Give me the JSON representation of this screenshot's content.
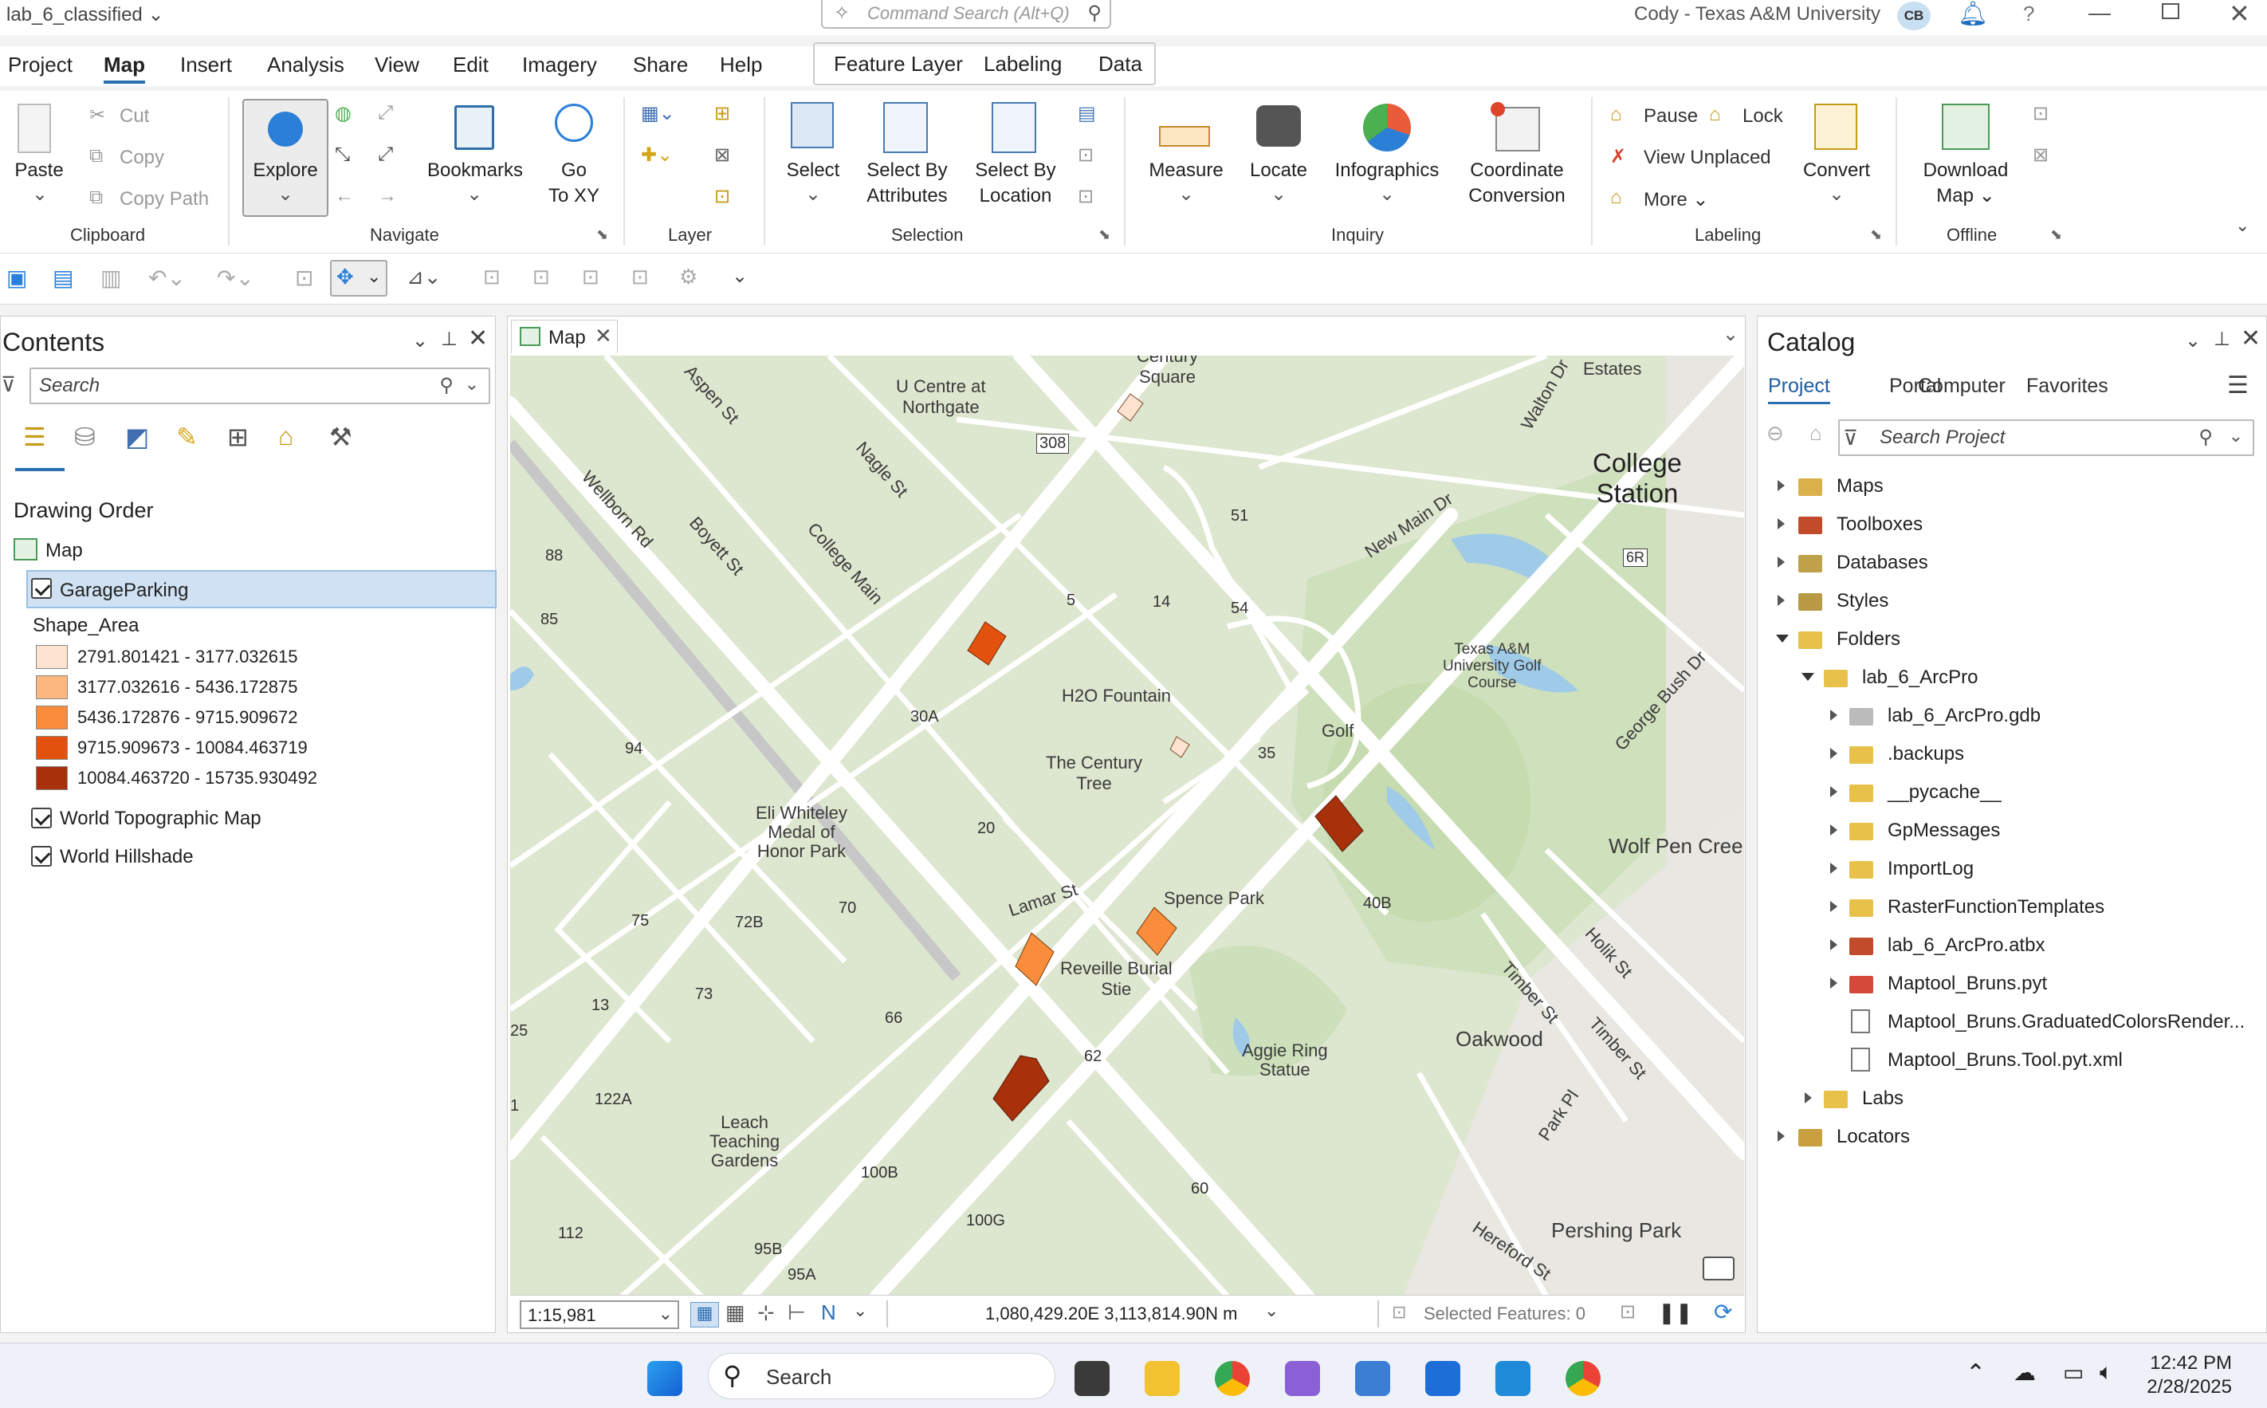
{
  "window": {
    "title": "lab_6_classified",
    "command_search_placeholder": "Command Search (Alt+Q)",
    "user": "Cody - Texas A&M University",
    "avatar_initials": "CB"
  },
  "ribbon_tabs": [
    "Project",
    "Map",
    "Insert",
    "Analysis",
    "View",
    "Edit",
    "Imagery",
    "Share",
    "Help"
  ],
  "active_tab": "Map",
  "context_tabs": [
    "Feature Layer",
    "Labeling",
    "Data"
  ],
  "ribbon": {
    "clipboard": {
      "paste": "Paste",
      "cut": "Cut",
      "copy": "Copy",
      "copy_path": "Copy Path",
      "group": "Clipboard"
    },
    "navigate": {
      "explore": "Explore",
      "bookmarks": "Bookmarks",
      "goto_xy_1": "Go",
      "goto_xy_2": "To XY",
      "group": "Navigate"
    },
    "layer": {
      "group": "Layer"
    },
    "selection": {
      "select": "Select",
      "by_attr_1": "Select By",
      "by_attr_2": "Attributes",
      "by_loc_1": "Select By",
      "by_loc_2": "Location",
      "group": "Selection"
    },
    "inquiry": {
      "measure": "Measure",
      "locate": "Locate",
      "infographics": "Infographics",
      "coord_1": "Coordinate",
      "coord_2": "Conversion",
      "group": "Inquiry"
    },
    "labeling": {
      "pause": "Pause",
      "lock": "Lock",
      "view_unplaced": "View Unplaced",
      "more": "More",
      "convert": "Convert",
      "group": "Labeling"
    },
    "offline": {
      "download_1": "Download",
      "download_2": "Map",
      "group": "Offline"
    }
  },
  "contents": {
    "title": "Contents",
    "search_placeholder": "Search",
    "drawing_order": "Drawing Order",
    "map": "Map",
    "layer": "GarageParking",
    "field": "Shape_Area",
    "legend": [
      {
        "label": "2791.801421 - 3177.032615",
        "color": "#fde3cf"
      },
      {
        "label": "3177.032616 - 5436.172875",
        "color": "#fbb77f"
      },
      {
        "label": "5436.172876 - 9715.909672",
        "color": "#f98d3c"
      },
      {
        "label": "9715.909673 - 10084.463719",
        "color": "#e2520e"
      },
      {
        "label": "10084.463720 - 15735.930492",
        "color": "#a8300b"
      }
    ],
    "basemaps": [
      "World Topographic Map",
      "World Hillshade"
    ]
  },
  "map": {
    "tab": "Map",
    "scale": "1:15,981",
    "coordinates": "1,080,429.20E 3,113,814.90N m",
    "selected_features": "Selected Features: 0",
    "labels": {
      "century_sq_1": "Century",
      "century_sq_2": "Square",
      "ucentre_1": "U Centre at",
      "ucentre_2": "Northgate",
      "college_station_1": "College",
      "college_station_2": "Station",
      "estates": "Estates",
      "h2o": "H2O Fountain",
      "century_tree_1": "The Century",
      "century_tree_2": "Tree",
      "golf": "Golf",
      "tamu_golf_1": "Texas A&M",
      "tamu_golf_2": "University Golf",
      "tamu_golf_3": "Course",
      "eli_1": "Eli Whiteley",
      "eli_2": "Medal of",
      "eli_3": "Honor Park",
      "spence": "Spence Park",
      "reveille_1": "Reveille Burial",
      "reveille_2": "Stie",
      "aggie_1": "Aggie Ring",
      "aggie_2": "Statue",
      "leach_1": "Leach",
      "leach_2": "Teaching",
      "leach_3": "Gardens",
      "wolf_pen": "Wolf Pen Creel",
      "oakwood": "Oakwood",
      "pershing": "Pershing Park",
      "wellborn": "Wellborn Rd",
      "boyett": "Boyett St",
      "college_main": "College Main",
      "nagle": "Nagle St",
      "aspen": "Aspen St",
      "lamar": "Lamar St",
      "new_main": "New Main Dr",
      "george_bush": "George Bush Dr",
      "holik": "Holik St",
      "timber": "Timber St",
      "park_pl": "Park Pl",
      "hereford": "Hereford St",
      "walton": "Walton Dr"
    },
    "numbers": [
      "308",
      "88",
      "85",
      "94",
      "75",
      "13",
      "25",
      "1",
      "122A",
      "112",
      "95B",
      "95A",
      "100B",
      "100G",
      "66",
      "73",
      "72B",
      "70",
      "20",
      "30A",
      "5",
      "14",
      "51",
      "54",
      "35",
      "40B",
      "62",
      "60",
      "6R"
    ]
  },
  "catalog": {
    "title": "Catalog",
    "tabs": [
      "Project",
      "Portal",
      "Computer",
      "Favorites"
    ],
    "search_placeholder": "Search Project",
    "items": {
      "maps": "Maps",
      "toolboxes": "Toolboxes",
      "databases": "Databases",
      "styles": "Styles",
      "folders": "Folders",
      "lab6": "lab_6_ArcPro",
      "gdb": "lab_6_ArcPro.gdb",
      "backups": ".backups",
      "pycache": "__pycache__",
      "gpmessages": "GpMessages",
      "importlog": "ImportLog",
      "raster": "RasterFunctionTemplates",
      "atbx": "lab_6_ArcPro.atbx",
      "maptool": "Maptool_Bruns.pyt",
      "render": "Maptool_Bruns.GraduatedColorsRender...",
      "toolxml": "Maptool_Bruns.Tool.pyt.xml",
      "labs": "Labs",
      "locators": "Locators"
    }
  },
  "taskbar": {
    "search": "Search",
    "time": "12:42 PM",
    "date": "2/28/2025"
  }
}
